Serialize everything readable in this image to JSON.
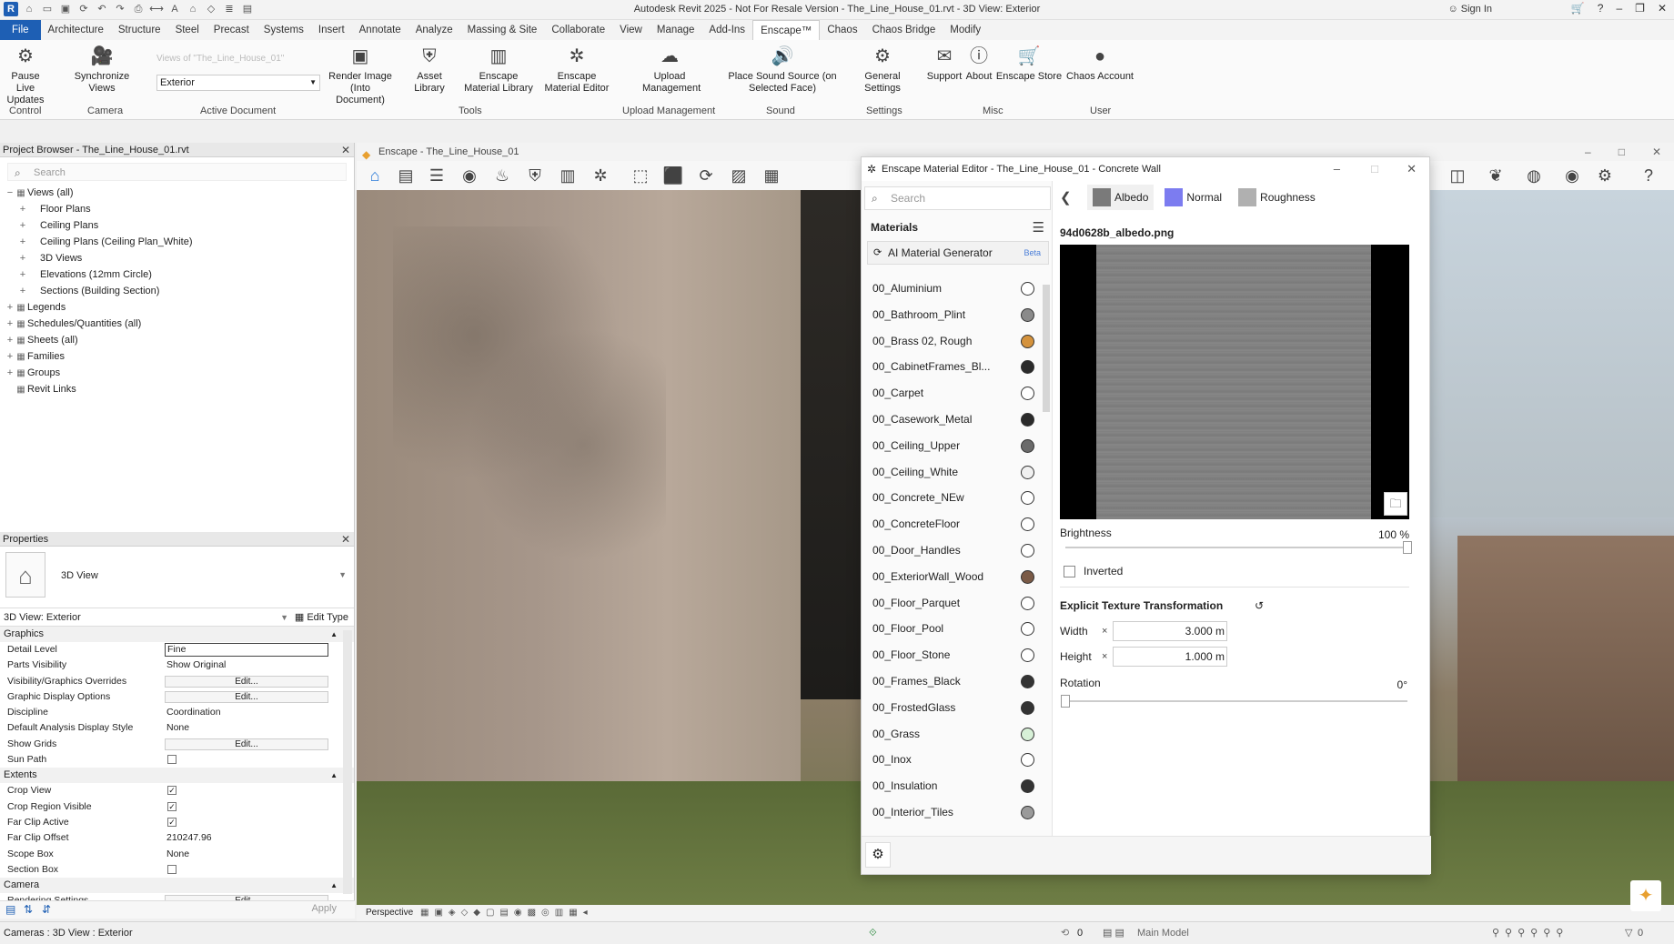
{
  "app": {
    "title": "Autodesk Revit 2025 - Not For Resale Version - The_Line_House_01.rvt - 3D View: Exterior",
    "sign_in": "Sign In"
  },
  "menu": [
    "File",
    "Architecture",
    "Structure",
    "Steel",
    "Precast",
    "Systems",
    "Insert",
    "Annotate",
    "Analyze",
    "Massing & Site",
    "Collaborate",
    "View",
    "Manage",
    "Add-Ins",
    "Enscape™",
    "Chaos",
    "Chaos Bridge",
    "Modify"
  ],
  "ribbon": {
    "buttons": [
      {
        "label": "Pause Live Updates",
        "icon": "pause-live-icon"
      },
      {
        "label": "Synchronize Views",
        "icon": "camera-icon"
      },
      {
        "label": "Render Image (Into Document)",
        "icon": "render-icon"
      },
      {
        "label": "Asset Library",
        "icon": "asset-library-icon"
      },
      {
        "label": "Enscape Material Library",
        "icon": "material-library-icon"
      },
      {
        "label": "Enscape Material Editor",
        "icon": "material-editor-icon"
      },
      {
        "label": "Upload Management",
        "icon": "upload-icon"
      },
      {
        "label": "Place Sound Source (on Selected Face)",
        "icon": "sound-icon"
      },
      {
        "label": "General Settings",
        "icon": "settings-icon"
      },
      {
        "label": "Support",
        "icon": "support-icon"
      },
      {
        "label": "About",
        "icon": "about-icon"
      },
      {
        "label": "Enscape Store",
        "icon": "store-icon"
      },
      {
        "label": "Chaos Account",
        "icon": "account-icon"
      }
    ],
    "groups": [
      "Control",
      "Camera",
      "Active Document",
      "Tools",
      "Upload Management",
      "Sound",
      "Settings",
      "Misc",
      "User"
    ],
    "view_hint": "Views of \"The_Line_House_01\"",
    "view_select": "Exterior"
  },
  "project_browser": {
    "title": "Project Browser - The_Line_House_01.rvt",
    "search_placeholder": "Search",
    "items": [
      {
        "label": "Views (all)",
        "level": 0,
        "pm": "−"
      },
      {
        "label": "Floor Plans",
        "level": 1,
        "pm": "+"
      },
      {
        "label": "Ceiling Plans",
        "level": 1,
        "pm": "+"
      },
      {
        "label": "Ceiling Plans (Ceiling Plan_White)",
        "level": 1,
        "pm": "+"
      },
      {
        "label": "3D Views",
        "level": 1,
        "pm": "+"
      },
      {
        "label": "Elevations (12mm Circle)",
        "level": 1,
        "pm": "+"
      },
      {
        "label": "Sections (Building Section)",
        "level": 1,
        "pm": "+"
      },
      {
        "label": "Legends",
        "level": 0,
        "pm": "+"
      },
      {
        "label": "Schedules/Quantities (all)",
        "level": 0,
        "pm": "+"
      },
      {
        "label": "Sheets (all)",
        "level": 0,
        "pm": "+"
      },
      {
        "label": "Families",
        "level": 0,
        "pm": "+"
      },
      {
        "label": "Groups",
        "level": 0,
        "pm": "+"
      },
      {
        "label": "Revit Links",
        "level": 0,
        "pm": ""
      }
    ]
  },
  "properties": {
    "title": "Properties",
    "type_name": "3D View",
    "selector": "3D View: Exterior",
    "edit_type": "Edit Type",
    "apply": "Apply",
    "sections": {
      "graphics": "Graphics",
      "extents": "Extents",
      "camera": "Camera"
    },
    "graphics_rows": [
      {
        "k": "Detail Level",
        "v": "Fine",
        "kind": "input"
      },
      {
        "k": "Parts Visibility",
        "v": "Show Original",
        "kind": "text"
      },
      {
        "k": "Visibility/Graphics Overrides",
        "v": "Edit...",
        "kind": "btn"
      },
      {
        "k": "Graphic Display Options",
        "v": "Edit...",
        "kind": "btn"
      },
      {
        "k": "Discipline",
        "v": "Coordination",
        "kind": "text"
      },
      {
        "k": "Default Analysis Display Style",
        "v": "None",
        "kind": "text"
      },
      {
        "k": "Show Grids",
        "v": "Edit...",
        "kind": "btn"
      },
      {
        "k": "Sun Path",
        "v": "",
        "kind": "cb"
      }
    ],
    "extents_rows": [
      {
        "k": "Crop View",
        "v": "✓",
        "kind": "cb"
      },
      {
        "k": "Crop Region Visible",
        "v": "✓",
        "kind": "cb"
      },
      {
        "k": "Far Clip Active",
        "v": "✓",
        "kind": "cb"
      },
      {
        "k": "Far Clip Offset",
        "v": "210247.96",
        "kind": "text"
      },
      {
        "k": "Scope Box",
        "v": "None",
        "kind": "text"
      },
      {
        "k": "Section Box",
        "v": "",
        "kind": "cb"
      }
    ],
    "camera_rows": [
      {
        "k": "Rendering Settings",
        "v": "Edit...",
        "kind": "btn"
      }
    ]
  },
  "enscape": {
    "title": "Enscape - The_Line_House_01"
  },
  "material_editor": {
    "title": "Enscape Material Editor - The_Line_House_01 - Concrete Wall",
    "search_placeholder": "Search",
    "materials_title": "Materials",
    "ai_generator": "AI Material Generator",
    "beta": "Beta",
    "materials": [
      {
        "name": "00_Aluminium",
        "color": "#ffffff"
      },
      {
        "name": "00_Bathroom_Plint",
        "color": "#8a8a8a"
      },
      {
        "name": "00_Brass 02, Rough",
        "color": "#d4923c"
      },
      {
        "name": "00_CabinetFrames_Bl...",
        "color": "#2a2a2a"
      },
      {
        "name": "00_Carpet",
        "color": "#ffffff"
      },
      {
        "name": "00_Casework_Metal",
        "color": "#2a2a2a"
      },
      {
        "name": "00_Ceiling_Upper",
        "color": "#6a6a6a"
      },
      {
        "name": "00_Ceiling_White",
        "color": "#f0f0f0"
      },
      {
        "name": "00_Concrete_NEw",
        "color": "#ffffff"
      },
      {
        "name": "00_ConcreteFloor",
        "color": "#ffffff"
      },
      {
        "name": "00_Door_Handles",
        "color": "#ffffff"
      },
      {
        "name": "00_ExteriorWall_Wood",
        "color": "#7a5a46"
      },
      {
        "name": "00_Floor_Parquet",
        "color": "#ffffff"
      },
      {
        "name": "00_Floor_Pool",
        "color": "#ffffff"
      },
      {
        "name": "00_Floor_Stone",
        "color": "#ffffff"
      },
      {
        "name": "00_Frames_Black",
        "color": "#333333"
      },
      {
        "name": "00_FrostedGlass",
        "color": "#333333"
      },
      {
        "name": "00_Grass",
        "color": "#d7f0d7"
      },
      {
        "name": "00_Inox",
        "color": "#ffffff"
      },
      {
        "name": "00_Insulation",
        "color": "#333333"
      },
      {
        "name": "00_Interior_Tiles",
        "color": "#9a9a9a"
      }
    ],
    "tabs": [
      {
        "label": "Albedo",
        "color": "#7a7a7a"
      },
      {
        "label": "Normal",
        "color": "#7c7cf0"
      },
      {
        "label": "Roughness",
        "color": "#b0b0b0"
      }
    ],
    "texture_file": "94d0628b_albedo.png",
    "brightness_label": "Brightness",
    "brightness_value": "100 %",
    "brightness_fraction": 1.0,
    "inverted_label": "Inverted",
    "explicit_label": "Explicit Texture Transformation",
    "width_label": "Width",
    "height_label": "Height",
    "times": "×",
    "width_value": "3.000 m",
    "height_value": "1.000 m",
    "rotation_label": "Rotation",
    "rotation_value": "0°",
    "rotation_fraction": 0.0
  },
  "viewbar": {
    "perspective": "Perspective"
  },
  "status": {
    "left": "Cameras : 3D View : Exterior",
    "model": "Main Model",
    "count": "0"
  }
}
